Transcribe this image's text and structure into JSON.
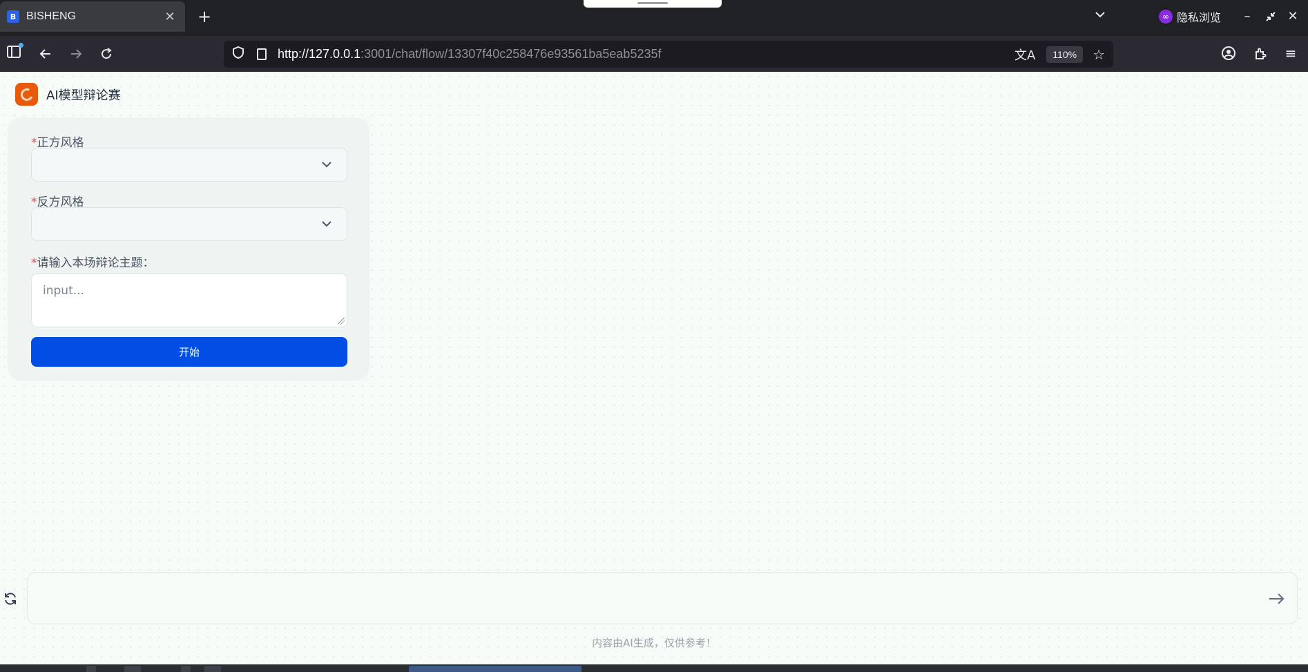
{
  "browser": {
    "tab_title": "BISHENG",
    "tab_favicon": "B",
    "close_glyph": "✕",
    "new_tab_glyph": "+",
    "private_label": "隐私浏览",
    "url_host": "http://127.0.0.1",
    "url_path": ":3001/chat/flow/13307f40c258476e93561ba5eab5235f",
    "zoom": "110%"
  },
  "icons": {
    "back": "back-arrow-icon",
    "forward": "forward-arrow-icon",
    "reload": "reload-icon",
    "shield": "shield-icon",
    "translate": "translate-icon",
    "star": "star-icon",
    "account": "account-icon",
    "extensions": "extensions-icon",
    "menu": "hamburger-menu-icon"
  },
  "app": {
    "title": "AI模型辩论赛"
  },
  "form": {
    "required_mark": "*",
    "field1_label": "正方风格",
    "field2_label": "反方风格",
    "field3_label": "请输入本场辩论主题：",
    "topic_placeholder": "input...",
    "start_label": "开始"
  },
  "chat": {
    "input_value": "",
    "disclaimer": "内容由AI生成，仅供参考！"
  },
  "colors": {
    "primary": "#024de3",
    "required": "#ef4444",
    "logo": "#e8590c"
  }
}
